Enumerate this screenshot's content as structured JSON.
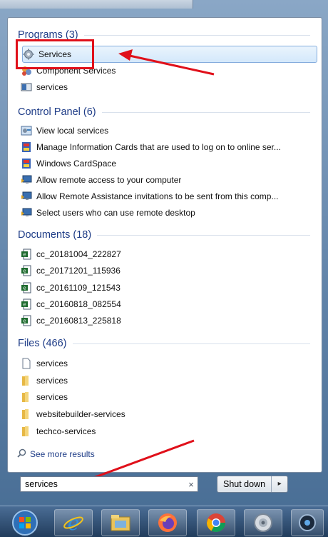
{
  "start_menu": {
    "groups": [
      {
        "header": "Programs (3)",
        "items": [
          {
            "label": "Services",
            "icon": "services-gear-icon"
          },
          {
            "label": "Component Services",
            "icon": "component-services-icon"
          },
          {
            "label": "services",
            "icon": "console-icon"
          }
        ]
      },
      {
        "header": "Control Panel (6)",
        "items": [
          {
            "label": "View local services",
            "icon": "control-panel-icon"
          },
          {
            "label": "Manage Information Cards that are used to log on to online ser...",
            "icon": "cardspace-icon"
          },
          {
            "label": "Windows CardSpace",
            "icon": "cardspace-icon"
          },
          {
            "label": "Allow remote access to your computer",
            "icon": "remote-icon"
          },
          {
            "label": "Allow Remote Assistance invitations to be sent from this comp...",
            "icon": "remote-icon"
          },
          {
            "label": "Select users who can use remote desktop",
            "icon": "remote-icon"
          }
        ]
      },
      {
        "header": "Documents (18)",
        "items": [
          {
            "label": "cc_20181004_222827",
            "icon": "document-icon"
          },
          {
            "label": "cc_20171201_115936",
            "icon": "document-icon"
          },
          {
            "label": "cc_20161109_121543",
            "icon": "document-icon"
          },
          {
            "label": "cc_20160818_082554",
            "icon": "document-icon"
          },
          {
            "label": "cc_20160813_225818",
            "icon": "document-icon"
          }
        ]
      },
      {
        "header": "Files (466)",
        "items": [
          {
            "label": "services",
            "icon": "file-icon"
          },
          {
            "label": "services",
            "icon": "folder-icon"
          },
          {
            "label": "services",
            "icon": "folder-icon"
          },
          {
            "label": "websitebuilder-services",
            "icon": "folder-icon"
          },
          {
            "label": "techco-services",
            "icon": "folder-icon"
          }
        ]
      }
    ],
    "see_more": "See more results",
    "search": {
      "value": "services",
      "clear": "×"
    },
    "shutdown": {
      "label": "Shut down",
      "arrow": "▸"
    }
  },
  "taskbar": {
    "buttons": [
      "start-orb-icon",
      "internet-explorer-icon",
      "file-explorer-icon",
      "firefox-icon",
      "chrome-icon",
      "speaker-icon",
      "app-icon"
    ]
  },
  "colors": {
    "header": "#1e3c87",
    "highlight_border": "#84acdd",
    "annotation_red": "#e0101a"
  }
}
